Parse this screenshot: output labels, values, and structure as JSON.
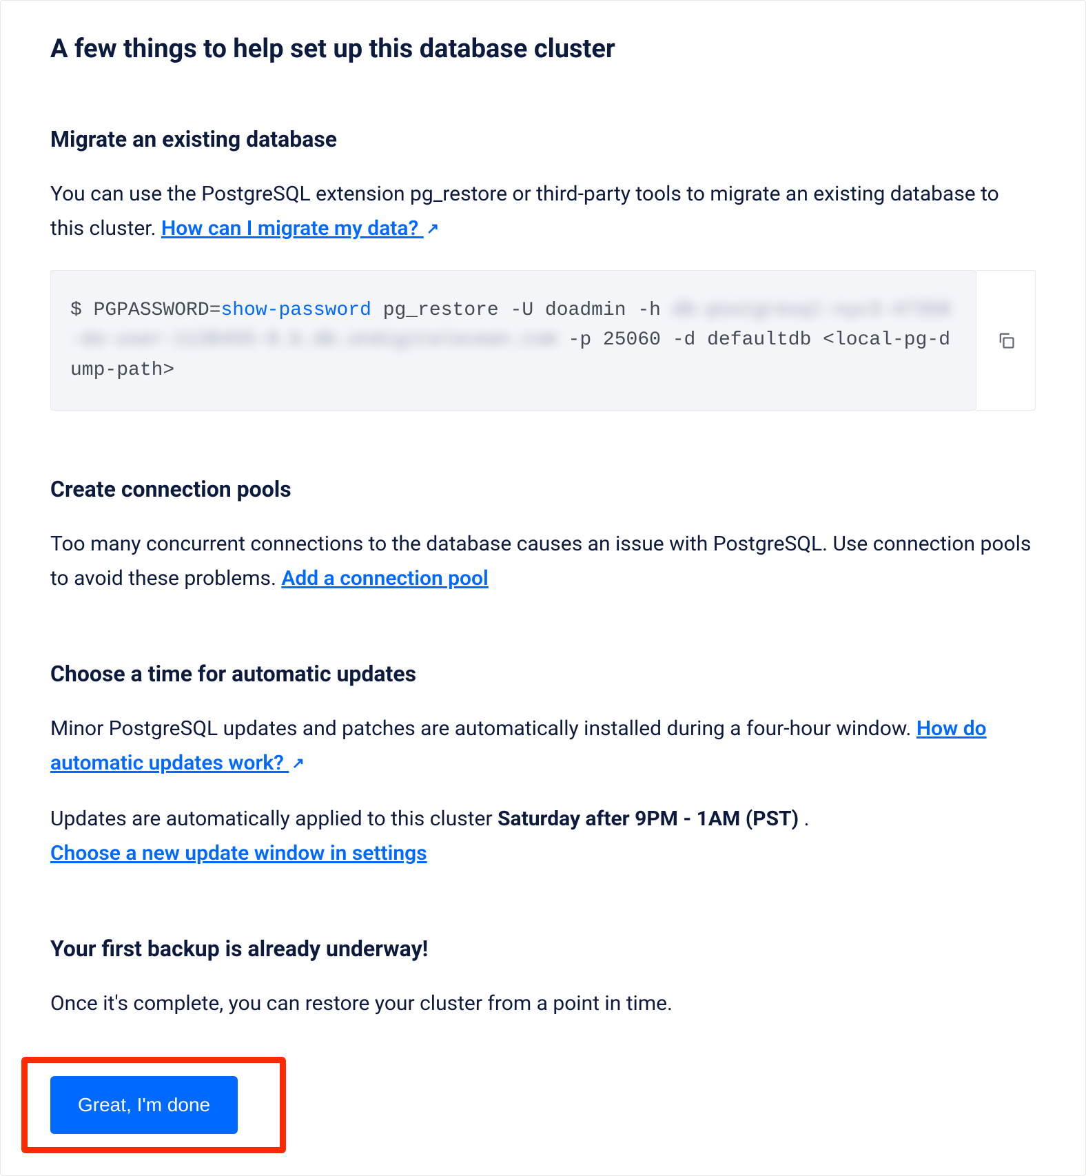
{
  "title": "A few things to help set up this database cluster",
  "sections": {
    "migrate": {
      "heading": "Migrate an existing database",
      "body_pre": "You can use the PostgreSQL extension pg_restore or third-party tools to migrate an existing database to this cluster. ",
      "link_text": "How can I migrate my data? ",
      "code": {
        "prompt": "$ ",
        "prefix": "PGPASSWORD=",
        "show_password": "show-password",
        "part1": " pg_restore -U doadmin -h ",
        "blur1": "db-postgresql-nyc3-47358-do-user-1138455-0.b.db.ondigitalocean.com",
        "part2": " -p 25060 -d defaultdb <local-pg-dump-path>"
      }
    },
    "pools": {
      "heading": "Create connection pools",
      "body_pre": "Too many concurrent connections to the database causes an issue with PostgreSQL. Use connection pools to avoid these problems. ",
      "link_text": "Add a connection pool"
    },
    "updates": {
      "heading": "Choose a time for automatic updates",
      "body_pre": "Minor PostgreSQL updates and patches are automatically installed during a four-hour window. ",
      "link_text": "How do automatic updates work? ",
      "applied_pre": "Updates are automatically applied to this cluster ",
      "applied_bold": "Saturday after 9PM - 1AM (PST)",
      "applied_post": " . ",
      "settings_link": "Choose a new update window in settings"
    },
    "backup": {
      "heading": "Your first backup is already underway!",
      "body": "Once it's complete, you can restore your cluster from a point in time."
    }
  },
  "button": {
    "done": "Great, I'm done"
  }
}
